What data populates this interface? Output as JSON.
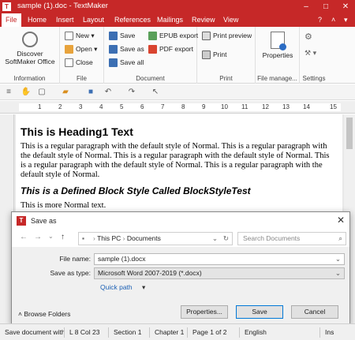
{
  "window": {
    "title": "sample (1).doc - TextMaker",
    "app_letter": "T",
    "minimize": "–",
    "maximize": "□",
    "close": "✕"
  },
  "menu": {
    "tabs": [
      "File",
      "Home",
      "Insert",
      "Layout",
      "References",
      "Mailings",
      "Review",
      "View"
    ],
    "active": "File",
    "right_icons": [
      "?",
      "˄",
      "▾"
    ]
  },
  "ribbon": {
    "information": {
      "label": "Information",
      "discover_line1": "Discover",
      "discover_line2": "SoftMaker Office"
    },
    "file": {
      "label": "File",
      "new": "New",
      "open": "Open",
      "close": "Close"
    },
    "document": {
      "label": "Document",
      "save": "Save",
      "save_as": "Save as",
      "save_all": "Save all",
      "epub_export": "EPUB export",
      "pdf_export": "PDF export"
    },
    "print": {
      "label": "Print",
      "print_preview": "Print preview",
      "print": "Print"
    },
    "file_manager": {
      "label": "File manage...",
      "properties": "Properties"
    },
    "settings": {
      "label": "Settings"
    }
  },
  "ruler": {
    "marks": [
      "1",
      "2",
      "3",
      "4",
      "5",
      "6",
      "7",
      "8",
      "9",
      "10",
      "11",
      "12",
      "13",
      "14",
      "15"
    ]
  },
  "document": {
    "heading1": "This is Heading1 Text",
    "paragraph": "This is a regular paragraph with the default style of Normal. This is a regular paragraph with the default style of Normal. This is a regular paragraph with the default style of Normal. This is a regular paragraph with the default style of Normal. This is a regular paragraph with the default style of Normal.",
    "heading2": "This is a Defined Block Style Called BlockStyleTest",
    "paragraph2": "This is more Normal text."
  },
  "dialog": {
    "title": "Save as",
    "close": "✕",
    "breadcrumb": [
      "This PC",
      "Documents"
    ],
    "search_placeholder": "Search Documents",
    "file_name_label": "File name:",
    "file_name_value": "sample (1).docx",
    "save_type_label": "Save as type:",
    "save_type_value": "Microsoft Word 2007-2019 (*.docx)",
    "quick_path": "Quick path",
    "browse_folders": "Browse Folders",
    "properties_button": "Properties...",
    "save_button": "Save",
    "cancel_button": "Cancel"
  },
  "statusbar": {
    "message": "Save document with",
    "position": "L 8 Col 23",
    "section": "Section 1",
    "chapter": "Chapter 1",
    "page": "Page 1 of 2",
    "language": "English",
    "mode": "Ins"
  },
  "colors": {
    "accent": "#c62828",
    "link": "#1a5fb4"
  }
}
